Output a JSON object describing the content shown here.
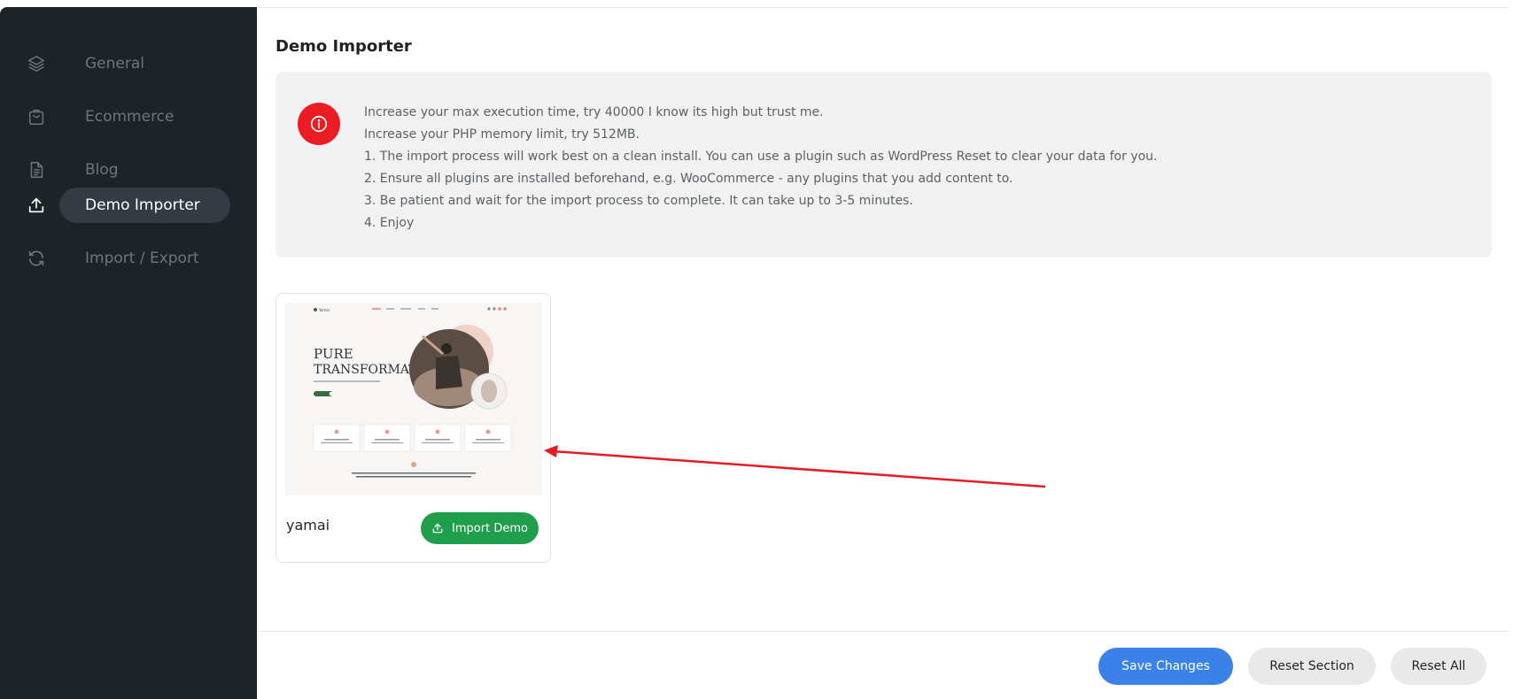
{
  "sidebar": {
    "items": [
      {
        "label": "General",
        "icon": "layers-icon"
      },
      {
        "label": "Ecommerce",
        "icon": "shopping-bag-icon"
      },
      {
        "label": "Blog",
        "icon": "document-icon"
      },
      {
        "label": "Demo Importer",
        "icon": "upload-icon",
        "active": true
      },
      {
        "label": "Import / Export",
        "icon": "refresh-icon"
      }
    ]
  },
  "main": {
    "title": "Demo Importer",
    "notice": {
      "icon": "info-icon",
      "lines": [
        "Increase your max execution time, try 40000 I know its high but trust me.",
        "Increase your PHP memory limit, try 512MB.",
        "1. The import process will work best on a clean install. You can use a plugin such as WordPress Reset to clear your data for you.",
        "2. Ensure all plugins are installed beforehand, e.g. WooCommerce - any plugins that you add content to.",
        "3. Be patient and wait for the import process to complete. It can take up to 3-5 minutes.",
        "4. Enjoy"
      ]
    },
    "demo": {
      "name": "yamai",
      "button_label": "Import Demo",
      "preview": {
        "logo": "Yamai",
        "headline_1": "PURE",
        "headline_2": "TRANSFORMATION"
      }
    }
  },
  "footer": {
    "save_label": "Save Changes",
    "reset_section_label": "Reset Section",
    "reset_all_label": "Reset All"
  },
  "colors": {
    "sidebar_bg": "#1e2328",
    "active_pill": "#353b42",
    "notice_icon": "#ec1c24",
    "import_button": "#1f9e4b",
    "save_button": "#3b82e8",
    "arrow": "#e31b23"
  }
}
